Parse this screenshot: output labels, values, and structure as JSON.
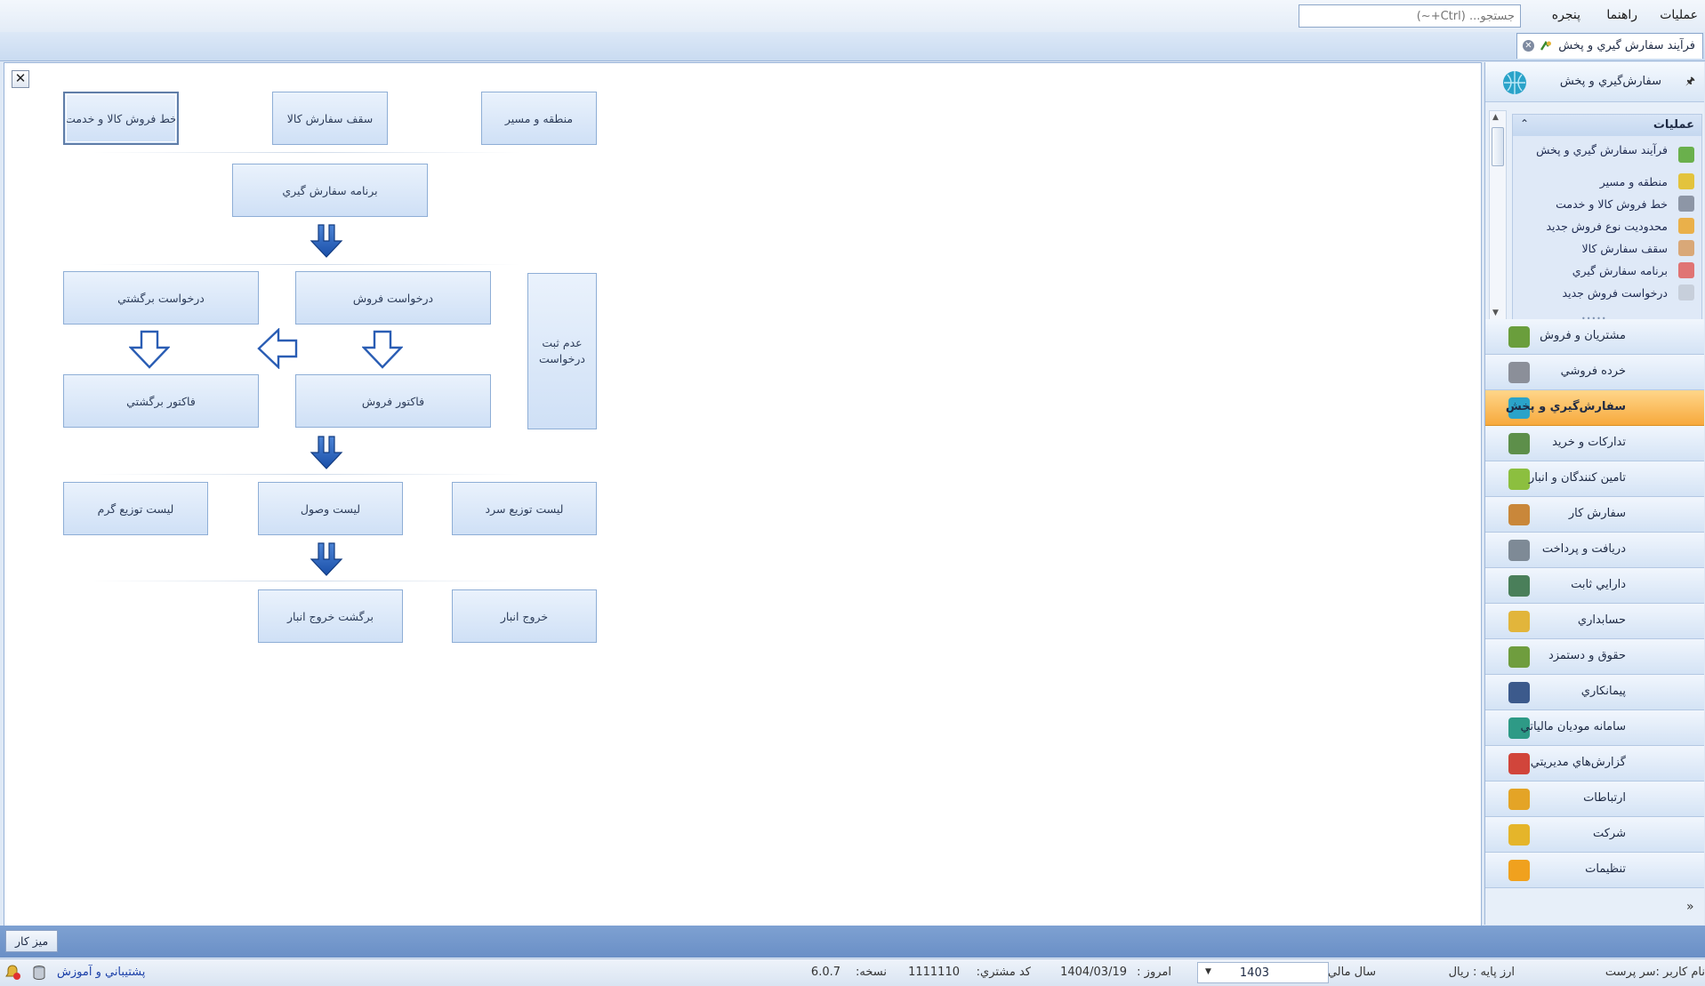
{
  "menu": {
    "operations": "عمليات",
    "help": "راهنما",
    "window": "پنجره"
  },
  "search": {
    "placeholder": "جستجو... (Ctrl+~)"
  },
  "tab": {
    "label": "فرآيند سفارش گيري و پخش"
  },
  "flow": {
    "row1": [
      "منطقه و مسير",
      "سقف سفارش کالا",
      "خط فروش کالا و خدمت"
    ],
    "program": "برنامه سفارش گيري",
    "sales_request": "درخواست فروش",
    "return_request": "درخواست برگشتي",
    "no_request": "عدم ثبت درخواست",
    "sales_invoice": "فاکتور فروش",
    "return_invoice": "فاکتور برگشتي",
    "row4": [
      "ليست توزيع سرد",
      "ليست وصول",
      "ليست توزيع گرم"
    ],
    "row5": [
      "خروج انبار",
      "برگشت خروج انبار"
    ]
  },
  "sidebar": {
    "title": "سفارش‌گيري و پخش",
    "ops_title": "عمليات",
    "ops": [
      "فرآيند سفارش گيري و پخش",
      "منطقه و مسير",
      "خط فروش کالا و خدمت",
      "محدوديت نوع فروش جديد",
      "سقف سفارش کالا",
      "برنامه سفارش گيري",
      "درخواست فروش جديد"
    ],
    "categories": [
      {
        "label": "مشتريان و فروش",
        "icon": "chart-icon",
        "color": "#6a9e3c"
      },
      {
        "label": "خرده فروشي",
        "icon": "cart-icon",
        "color": "#8b8f99"
      },
      {
        "label": "سفارش‌گيري و پخش",
        "icon": "globe-icon",
        "color": "#2aa3c9",
        "active": true
      },
      {
        "label": "تدارکات و خريد",
        "icon": "boxes-icon",
        "color": "#5d8f4a"
      },
      {
        "label": "تامين کنندگان و انبار",
        "icon": "warehouse-icon",
        "color": "#8cbf3f"
      },
      {
        "label": "سفارش کار",
        "icon": "tools-icon",
        "color": "#c9873a"
      },
      {
        "label": "دريافت و پرداخت",
        "icon": "money-icon",
        "color": "#7e8a96"
      },
      {
        "label": "دارايي ثابت",
        "icon": "truck-icon",
        "color": "#4a7f5a"
      },
      {
        "label": "حسابداري",
        "icon": "ledger-icon",
        "color": "#e2b53b"
      },
      {
        "label": "حقوق و دستمزد",
        "icon": "cash-icon",
        "color": "#6f9d3e"
      },
      {
        "label": "پيمانکاري",
        "icon": "helmet-icon",
        "color": "#3c5a8c"
      },
      {
        "label": "سامانه موديان مالياتي",
        "icon": "tax-icon",
        "color": "#2e9a86"
      },
      {
        "label": "گزارش‌هاي مديريتي",
        "icon": "report-icon",
        "color": "#d1453b"
      },
      {
        "label": "ارتباطات",
        "icon": "phone-icon",
        "color": "#e4a426"
      },
      {
        "label": "شرکت",
        "icon": "people-icon",
        "color": "#e5b52a"
      },
      {
        "label": "تنظيمات",
        "icon": "settings-icon",
        "color": "#f0a11e"
      }
    ]
  },
  "taskbar": {
    "desktop": "ميز کار"
  },
  "status": {
    "user": "نام کاربر :سر پرست",
    "base_currency": "ارز پايه :   ريال",
    "fiscal_year_label": "سال مالي:",
    "fiscal_year": "1403",
    "today_label": "امروز :",
    "today": "1404/03/19",
    "customer_code_label": "کد مشتري:",
    "customer_code": "1111110",
    "version_label": "نسخه:",
    "version": "6.0.7",
    "support": "پشتيباني و آموزش"
  }
}
